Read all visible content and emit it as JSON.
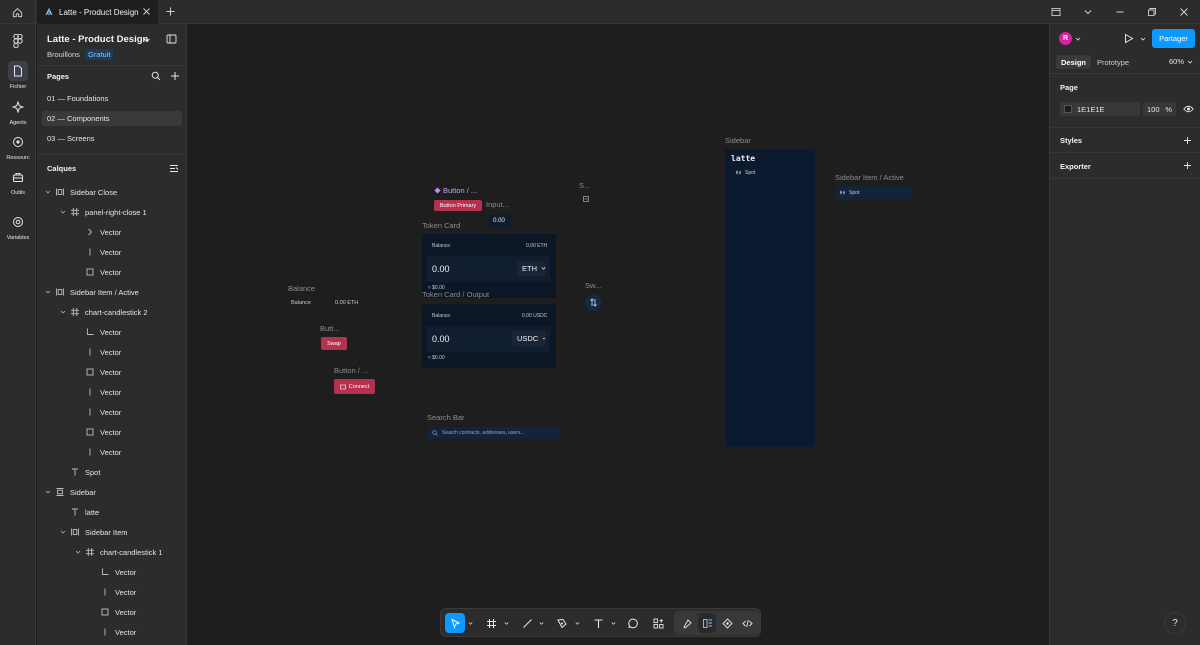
{
  "tab": {
    "title": "Latte - Product Design"
  },
  "rail": [
    {
      "label": "Fichier",
      "icon": "file-icon",
      "active": true
    },
    {
      "label": "Agents",
      "icon": "agents-icon",
      "active": false
    },
    {
      "label": "Ressourc",
      "icon": "resources-icon",
      "active": false
    },
    {
      "label": "Outils",
      "icon": "tools-icon",
      "active": false
    },
    {
      "label": "Variables",
      "icon": "variables-icon",
      "active": false
    }
  ],
  "file": {
    "title": "Latte - Product Design",
    "location": "Brouillons",
    "plan": "Gratuit"
  },
  "pages": {
    "title": "Pages",
    "items": [
      {
        "label": "01 — Foundations",
        "selected": false
      },
      {
        "label": "02 — Components",
        "selected": true
      },
      {
        "label": "03 — Screens",
        "selected": false
      }
    ]
  },
  "layers": {
    "title": "Calques",
    "items": [
      {
        "label": "Sidebar Close",
        "type": "auto-layout",
        "depth": 0,
        "expanded": true
      },
      {
        "label": "panel-right-close 1",
        "type": "frame",
        "depth": 1,
        "expanded": true
      },
      {
        "label": "Vector",
        "type": "vector-chevron",
        "depth": 2
      },
      {
        "label": "Vector",
        "type": "vector-line",
        "depth": 2
      },
      {
        "label": "Vector",
        "type": "vector-rect",
        "depth": 2
      },
      {
        "label": "Sidebar Item / Active",
        "type": "auto-layout",
        "depth": 0,
        "expanded": true
      },
      {
        "label": "chart-candlestick 2",
        "type": "frame",
        "depth": 1,
        "expanded": true
      },
      {
        "label": "Vector",
        "type": "vector-corner",
        "depth": 2
      },
      {
        "label": "Vector",
        "type": "vector-line",
        "depth": 2
      },
      {
        "label": "Vector",
        "type": "vector-rect",
        "depth": 2
      },
      {
        "label": "Vector",
        "type": "vector-line",
        "depth": 2
      },
      {
        "label": "Vector",
        "type": "vector-line",
        "depth": 2
      },
      {
        "label": "Vector",
        "type": "vector-rect",
        "depth": 2
      },
      {
        "label": "Vector",
        "type": "vector-line",
        "depth": 2
      },
      {
        "label": "Spot",
        "type": "text",
        "depth": 1
      },
      {
        "label": "Sidebar",
        "type": "auto-layout-v",
        "depth": 0,
        "expanded": true
      },
      {
        "label": "latte",
        "type": "text",
        "depth": 1
      },
      {
        "label": "Sidebar Item",
        "type": "auto-layout",
        "depth": 1,
        "expanded": true
      },
      {
        "label": "chart-candlestick 1",
        "type": "frame",
        "depth": 2,
        "expanded": true
      },
      {
        "label": "Vector",
        "type": "vector-corner",
        "depth": 3
      },
      {
        "label": "Vector",
        "type": "vector-line",
        "depth": 3
      },
      {
        "label": "Vector",
        "type": "vector-rect",
        "depth": 3
      },
      {
        "label": "Vector",
        "type": "vector-line",
        "depth": 3
      }
    ]
  },
  "canvas": {
    "balance": {
      "frame_label": "Balance",
      "label": "Balance",
      "value": "0.00 ETH"
    },
    "button_swap": {
      "frame_label": "Butt...",
      "label": "Swap"
    },
    "button_connect": {
      "frame_label": "Button / ...",
      "label": "Connect"
    },
    "button_primary": {
      "frame_label": "Button / ...",
      "label": "Button Primary"
    },
    "input": {
      "frame_label": "Input...",
      "value": "0.00"
    },
    "s_frame": {
      "frame_label": "S..."
    },
    "swap_icon": {
      "frame_label": "Sw..."
    },
    "token_card": {
      "frame_label": "Token Card",
      "balance_label": "Balance",
      "balance_value": "0.00 ETH",
      "amount": "0.00",
      "token": "ETH",
      "usd": "≈ $0.00"
    },
    "token_output": {
      "frame_label": "Token Card / Output",
      "balance_label": "Balance",
      "balance_value": "0.00 USDC",
      "amount": "0.00",
      "token": "USDC",
      "usd": "≈ $0.00"
    },
    "search": {
      "frame_label": "Search Bar",
      "placeholder": "Search contracts, addresses, users..."
    },
    "sidebar": {
      "frame_label": "Sidebar",
      "logo": "latte",
      "item": "Spot"
    },
    "sidebar_item_active": {
      "frame_label": "Sidebar Item / Active",
      "item": "Spot"
    }
  },
  "right_panel": {
    "avatar_initial": "R",
    "share_label": "Partager",
    "tabs": [
      "Design",
      "Prototype"
    ],
    "zoom": "60%",
    "page_section": "Page",
    "page_color": "1E1E1E",
    "opacity": "100",
    "opacity_unit": "%",
    "styles_section": "Styles",
    "export_section": "Exporter"
  },
  "help_label": "?",
  "colors": {
    "accent": "#0d99ff",
    "primary_button": "#b4324f",
    "card_bg": "#0c1726",
    "canvas_bg": "#1e1e1e"
  }
}
